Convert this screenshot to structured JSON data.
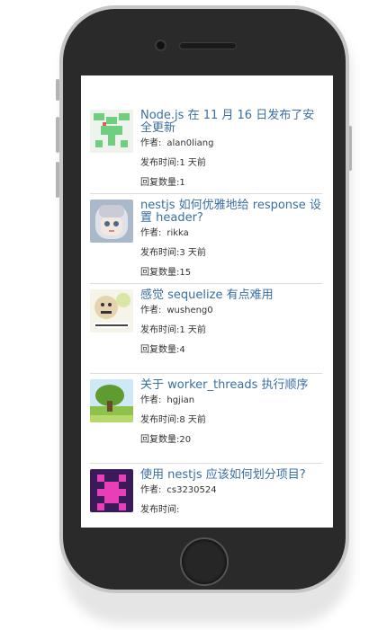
{
  "topics": [
    {
      "title": "Node.js 在 11 月 16 日发布了安全更新",
      "author_label": "作者:",
      "author": "alan0liang",
      "time_label": "发布时间:",
      "time": "1 天前",
      "replies_label": "回复数量:",
      "replies": "1",
      "avatar": "green-pixel-avatar"
    },
    {
      "title": "nestjs 如何优雅地给 response 设置 header?",
      "author_label": "作者:",
      "author": "rikka",
      "time_label": "发布时间:",
      "time": "3 天前",
      "replies_label": "回复数量:",
      "replies": "15",
      "avatar": "anime-girl-avatar"
    },
    {
      "title": "感觉 sequelize 有点难用",
      "author_label": "作者:",
      "author": "wusheng0",
      "time_label": "发布时间:",
      "time": "1 天前",
      "replies_label": "回复数量:",
      "replies": "4",
      "avatar": "meme-face-avatar"
    },
    {
      "title": "关于 worker_threads 执行顺序",
      "author_label": "作者:",
      "author": "hgjian",
      "time_label": "发布时间:",
      "time": "8 天前",
      "replies_label": "回复数量:",
      "replies": "20",
      "avatar": "landscape-tree-avatar"
    },
    {
      "title": "使用 nestjs 应该如何划分项目?",
      "author_label": "作者:",
      "author": "cs3230524",
      "time_label": "发布时间:",
      "time": "",
      "replies_label": "",
      "replies": "",
      "avatar": "purple-pixel-avatar"
    }
  ],
  "colors": {
    "title": "#3a6fa3",
    "divider": "#dcdcdc",
    "phone_body": "#2a2a2a",
    "phone_frame": "#c6c6c6"
  }
}
